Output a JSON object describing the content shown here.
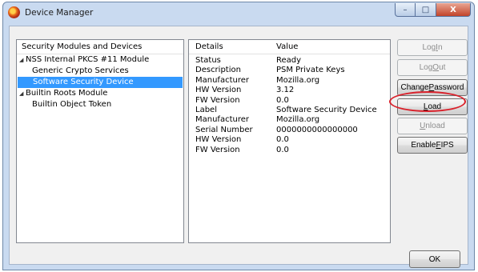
{
  "window": {
    "title": "Device Manager"
  },
  "caption_buttons": {
    "minimize": "–",
    "maximize": "□",
    "close": "X"
  },
  "tree": {
    "header": "Security Modules and Devices",
    "items": [
      {
        "label": "NSS Internal PKCS #11 Module",
        "twisty": "◢"
      },
      {
        "label": "Generic Crypto Services"
      },
      {
        "label": "Software Security Device",
        "selected": true
      },
      {
        "label": "Builtin Roots Module",
        "twisty": "◢"
      },
      {
        "label": "Builtin Object Token"
      }
    ]
  },
  "details": {
    "header_details": "Details",
    "header_value": "Value",
    "rows": [
      {
        "label": "Status",
        "value": "Ready"
      },
      {
        "label": "Description",
        "value": "PSM Private Keys"
      },
      {
        "label": "Manufacturer",
        "value": "Mozilla.org"
      },
      {
        "label": "HW Version",
        "value": "3.12"
      },
      {
        "label": "FW Version",
        "value": "0.0"
      },
      {
        "label": "Label",
        "value": "Software Security Device"
      },
      {
        "label": "Manufacturer",
        "value": "Mozilla.org"
      },
      {
        "label": "Serial Number",
        "value": "0000000000000000"
      },
      {
        "label": "HW Version",
        "value": "0.0"
      },
      {
        "label": "FW Version",
        "value": "0.0"
      }
    ]
  },
  "buttons": {
    "login_pre": "Log ",
    "login_key": "I",
    "login_post": "n",
    "logout_pre": "Log ",
    "logout_key": "O",
    "logout_post": "ut",
    "changepw_pre": "Change ",
    "changepw_key": "P",
    "changepw_post": "assword",
    "load_pre": "",
    "load_key": "L",
    "load_post": "oad",
    "unload_pre": "",
    "unload_key": "U",
    "unload_post": "nload",
    "fips_pre": "Enable ",
    "fips_key": "F",
    "fips_post": "IPS",
    "ok": "OK"
  },
  "colors": {
    "selection": "#3399ff",
    "annotation": "#d9212b",
    "window_frame": "#c9daf0"
  }
}
